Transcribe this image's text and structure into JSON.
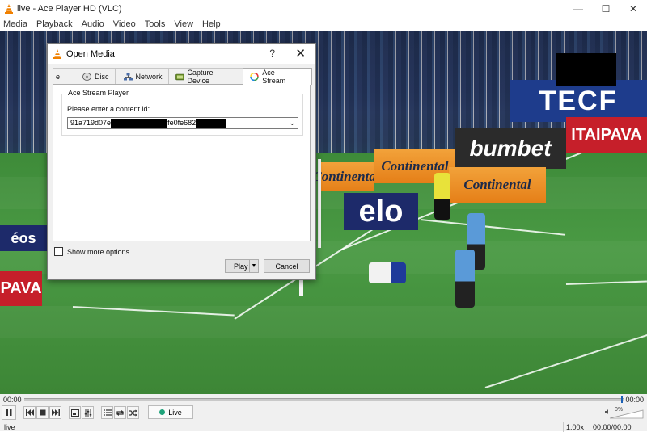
{
  "window": {
    "title": "live - Ace Player HD (VLC)",
    "minimize": "—",
    "maximize": "☐",
    "close": "✕"
  },
  "menu": [
    "Media",
    "Playback",
    "Audio",
    "Video",
    "Tools",
    "View",
    "Help"
  ],
  "video": {
    "boards": {
      "continental_1": "Continental",
      "continental_2": "Continental",
      "continental_3": "Continental",
      "bumbet": "bumbet",
      "elo": "elo",
      "itaipava": "ITAIPAVA",
      "left_board": "éos",
      "pava": "PAVA",
      "tec": "TECF"
    }
  },
  "dialog": {
    "title": "Open Media",
    "help": "?",
    "close": "✕",
    "tabs": [
      {
        "label": "e",
        "icon": "file-icon"
      },
      {
        "label": "Disc",
        "icon": "disc-icon"
      },
      {
        "label": "Network",
        "icon": "network-icon"
      },
      {
        "label": "Capture Device",
        "icon": "capture-device-icon"
      },
      {
        "label": "Ace Stream",
        "icon": "ace-stream-icon"
      }
    ],
    "scroll_left": "◀",
    "scroll_right": "▶",
    "group_label": "Ace Stream Player",
    "field_label": "Please enter a content id:",
    "content_id_part1": "91a719d07e",
    "content_id_part2": "fe0fe682",
    "show_more": "Show more options",
    "play": "Play",
    "cancel": "Cancel"
  },
  "controls": {
    "time_elapsed": "00:00",
    "time_total": "00:00",
    "live": "Live",
    "volume": "0%"
  },
  "status": {
    "left": "live",
    "speed": "1.00x",
    "time": "00:00/00:00"
  }
}
